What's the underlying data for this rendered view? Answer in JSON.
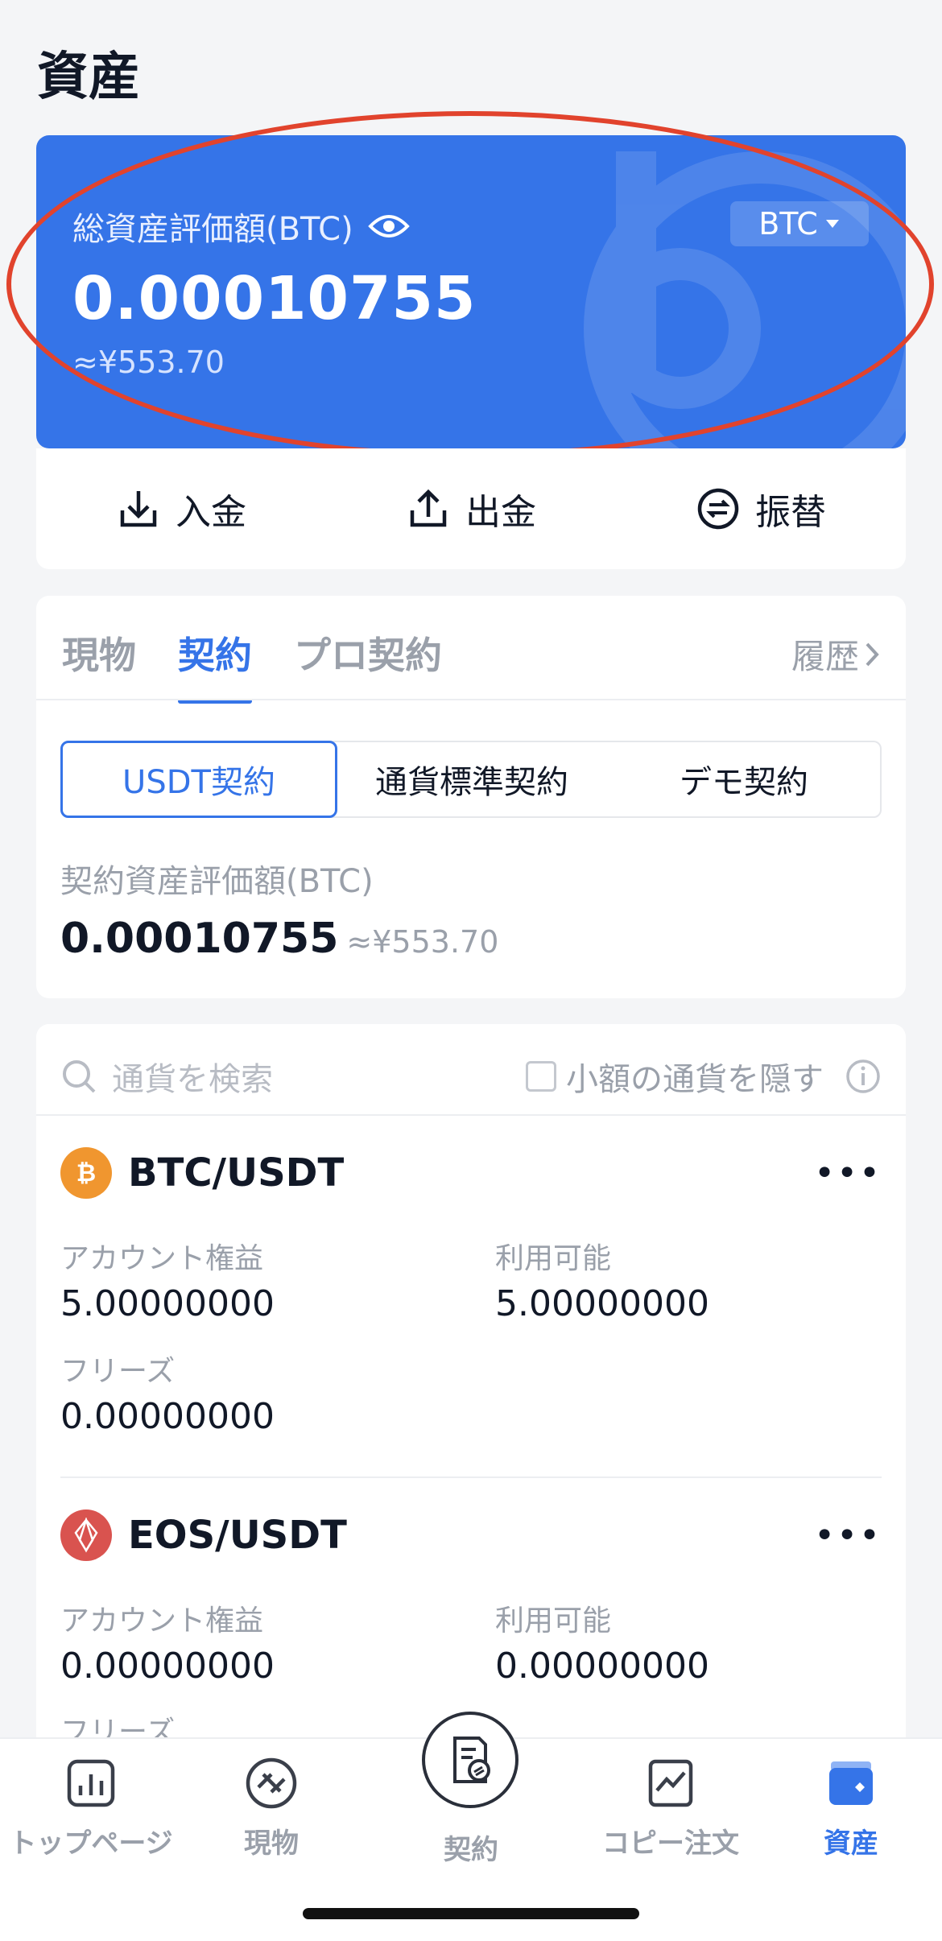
{
  "header": {
    "title": "資産"
  },
  "asset_card": {
    "label": "総資産評価額(BTC)",
    "value": "0.00010755",
    "approx": "≈¥553.70",
    "currency": "BTC"
  },
  "actions": [
    {
      "label": "入金",
      "icon": "deposit-icon"
    },
    {
      "label": "出金",
      "icon": "withdraw-icon"
    },
    {
      "label": "振替",
      "icon": "transfer-icon"
    }
  ],
  "contract_panel": {
    "tabs": [
      {
        "label": "現物",
        "active": false
      },
      {
        "label": "契約",
        "active": true
      },
      {
        "label": "プロ契約",
        "active": false
      }
    ],
    "history_label": "履歴",
    "segments": [
      {
        "label": "USDT契約",
        "active": true
      },
      {
        "label": "通貨標準契約",
        "active": false
      },
      {
        "label": "デモ契約",
        "active": false
      }
    ],
    "valuation_label": "契約資産評価額(BTC)",
    "valuation_value": "0.00010755",
    "valuation_approx": "≈¥553.70"
  },
  "list": {
    "search_placeholder": "通貨を検索",
    "hide_small_label": "小額の通貨を隠す",
    "pairs": [
      {
        "name": "BTC/USDT",
        "icon": "bitcoin-icon",
        "equity_label": "アカウント権益",
        "equity_value": "5.00000000",
        "available_label": "利用可能",
        "available_value": "5.00000000",
        "frozen_label": "フリーズ",
        "frozen_value": "0.00000000"
      },
      {
        "name": "EOS/USDT",
        "icon": "eos-icon",
        "equity_label": "アカウント権益",
        "equity_value": "0.00000000",
        "available_label": "利用可能",
        "available_value": "0.00000000",
        "frozen_label": "フリーズ"
      }
    ]
  },
  "bottom_nav": [
    {
      "label": "トップページ",
      "icon": "chart-bars-icon"
    },
    {
      "label": "現物",
      "icon": "spot-icon"
    },
    {
      "label": "契約",
      "icon": "contract-icon"
    },
    {
      "label": "コピー注文",
      "icon": "copy-trade-icon"
    },
    {
      "label": "資産",
      "icon": "wallet-icon",
      "active": true
    }
  ],
  "colors": {
    "accent": "#3574e8",
    "highlight_ellipse": "#e1432d",
    "bitcoin": "#f0962f",
    "eos": "#d9534f"
  }
}
